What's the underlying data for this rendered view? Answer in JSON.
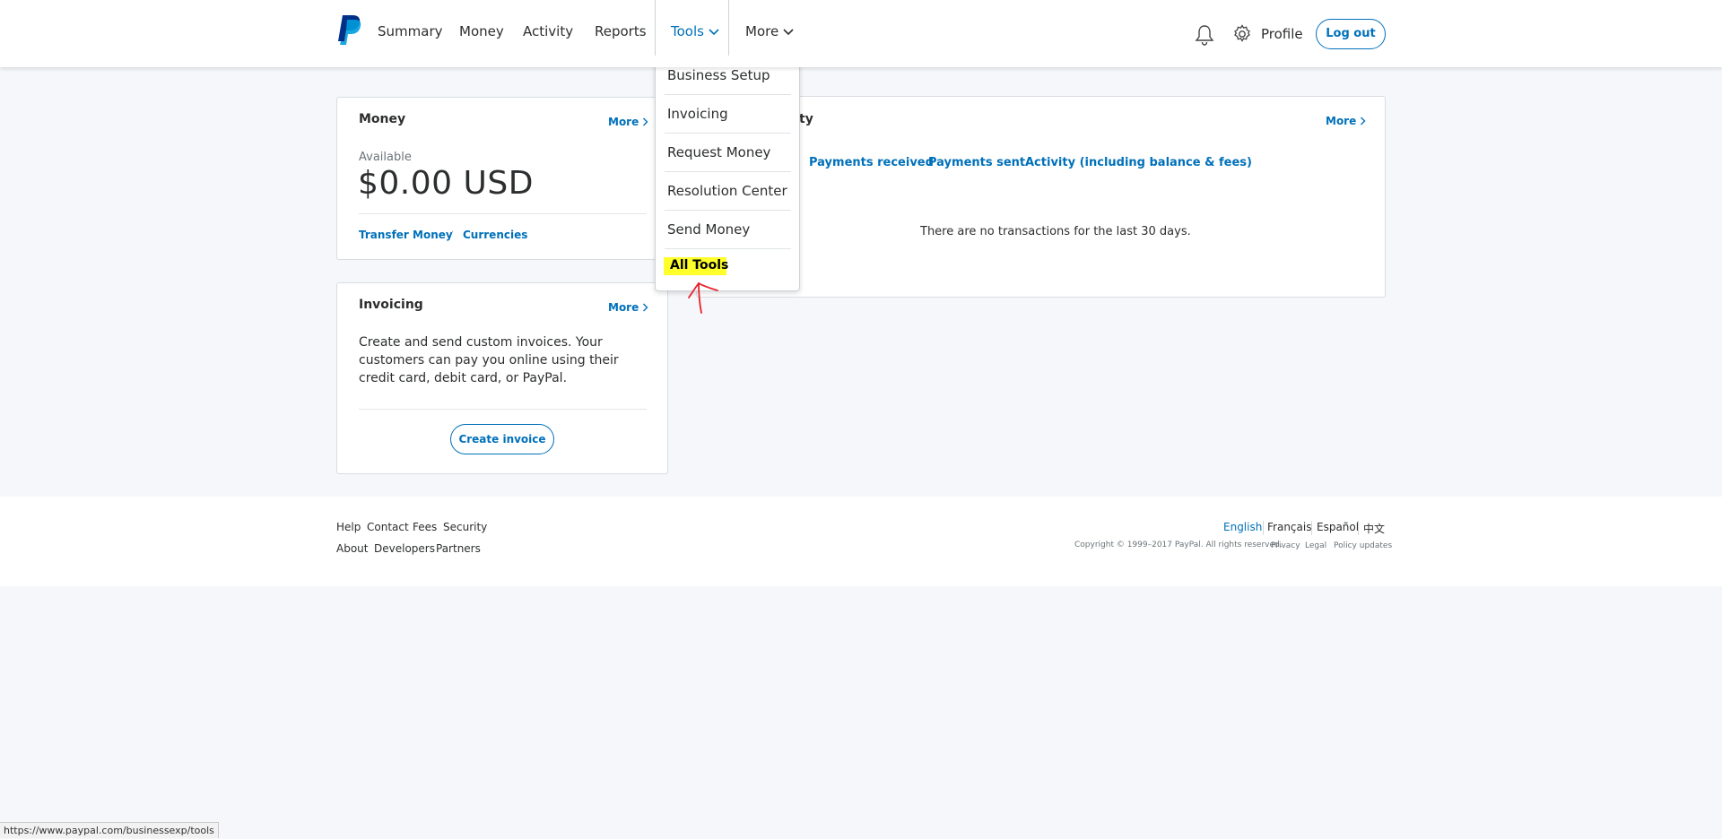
{
  "header": {
    "nav": {
      "summary": "Summary",
      "money": "Money",
      "activity": "Activity",
      "reports": "Reports",
      "tools": "Tools",
      "more": "More"
    },
    "profile": "Profile",
    "logout": "Log out"
  },
  "tools_menu": {
    "items": [
      "Business Setup",
      "Invoicing",
      "Request Money",
      "Resolution Center",
      "Send Money",
      "All Tools"
    ]
  },
  "money_card": {
    "title": "Money",
    "more": "More",
    "available_label": "Available",
    "balance": "$0.00 USD",
    "transfer_link": "Transfer Money",
    "currencies_link": "Currencies"
  },
  "invoicing_card": {
    "title": "Invoicing",
    "more": "More",
    "description": "Create and send custom invoices. Your customers can pay you online using their credit card, debit card, or PayPal.",
    "button": "Create invoice"
  },
  "activity_card": {
    "title_visible": "ty",
    "more": "More",
    "tabs": [
      "Payments received",
      "Payments sent",
      "Activity (including balance & fees)"
    ],
    "empty_message": "There are no transactions for the last 30 days."
  },
  "footer": {
    "row1": [
      "Help",
      "Contact",
      "Fees",
      "Security"
    ],
    "row2": [
      "About",
      "Developers",
      "Partners"
    ],
    "languages": [
      "English",
      "Français",
      "Español",
      "中文"
    ],
    "copyright": "Copyright © 1999–2017 PayPal. All rights reserved.",
    "legal": [
      "Privacy",
      "Legal",
      "Policy updates"
    ]
  },
  "status_bar": {
    "url": "https://www.paypal.com/businessexp/tools"
  },
  "colors": {
    "accent": "#0070ba",
    "highlight": "#ffff2a",
    "annotation": "#e8202a"
  },
  "icons": [
    "paypal-logo",
    "chevron-down-icon",
    "bell-icon",
    "gear-icon",
    "chevron-right-icon",
    "hand-drawn-arrow"
  ]
}
